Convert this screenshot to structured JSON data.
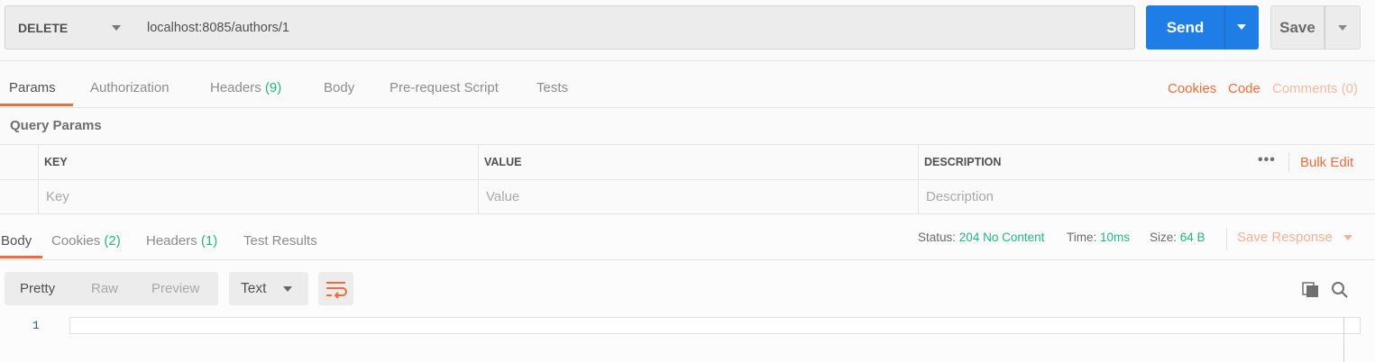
{
  "request": {
    "method": "DELETE",
    "url": "localhost:8085/authors/1",
    "send_label": "Send",
    "save_label": "Save"
  },
  "request_tabs": [
    {
      "label": "Params"
    },
    {
      "label": "Authorization"
    },
    {
      "label": "Headers",
      "count": "(9)"
    },
    {
      "label": "Body"
    },
    {
      "label": "Pre-request Script"
    },
    {
      "label": "Tests"
    }
  ],
  "right_links": {
    "cookies": "Cookies",
    "code": "Code",
    "comments": "Comments (0)"
  },
  "query_params": {
    "title": "Query Params",
    "columns": [
      "KEY",
      "VALUE",
      "DESCRIPTION"
    ],
    "placeholders": {
      "key": "Key",
      "value": "Value",
      "description": "Description"
    },
    "more": "•••",
    "bulk_edit": "Bulk Edit"
  },
  "response": {
    "tabs": [
      {
        "label": "Body"
      },
      {
        "label": "Cookies",
        "count": "(2)"
      },
      {
        "label": "Headers",
        "count": "(1)"
      },
      {
        "label": "Test Results"
      }
    ],
    "status_label": "Status:",
    "status_value": "204 No Content",
    "time_label": "Time:",
    "time_value": "10ms",
    "size_label": "Size:",
    "size_value": "64 B",
    "save_response": "Save Response",
    "view_modes": [
      "Pretty",
      "Raw",
      "Preview"
    ],
    "format": "Text",
    "line_number": "1"
  },
  "colors": {
    "accent_orange": "#f26b3a",
    "send_blue": "#1e7ee6",
    "success_green": "#26b47f"
  },
  "icons": [
    "caret-down-icon",
    "wrap-lines-icon",
    "copy-icon",
    "search-icon"
  ]
}
